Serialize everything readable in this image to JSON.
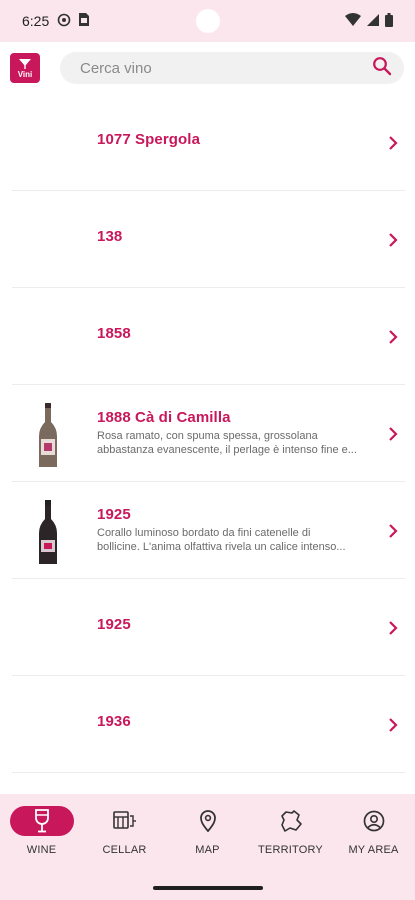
{
  "status_bar": {
    "time": "6:25"
  },
  "header": {
    "logo_text": "Vini",
    "search_placeholder": "Cerca vino"
  },
  "wines": [
    {
      "title": "1077 Spergola",
      "description": "",
      "has_image": false
    },
    {
      "title": "138",
      "description": "",
      "has_image": false
    },
    {
      "title": "1858",
      "description": "",
      "has_image": false
    },
    {
      "title": "1888 Cà di Camilla",
      "description_line1": "Rosa ramato, con spuma spessa, grossolana",
      "description_line2": "abbastanza evanescente, il perlage è intenso fine e...",
      "has_image": true,
      "bottle_color": "#6e5a4c"
    },
    {
      "title": "1925",
      "description_line1": "Corallo luminoso bordato da fini catenelle di",
      "description_line2": "bollicine. L'anima olfattiva rivela un calice intenso...",
      "has_image": true,
      "bottle_color": "#2a2326"
    },
    {
      "title": "1925",
      "description": "",
      "has_image": false
    },
    {
      "title": "1936",
      "description": "",
      "has_image": false
    }
  ],
  "nav": {
    "wine": "WINE",
    "cellar": "CELLAR",
    "map": "MAP",
    "territory": "TERRITORY",
    "my_area": "MY AREA"
  },
  "colors": {
    "accent": "#c8185b",
    "nav_bg": "#fbe6ee"
  },
  "icons": {
    "status": [
      "settings-icon",
      "sim-icon",
      "wifi-icon",
      "signal-icon",
      "battery-icon"
    ],
    "search": "search-icon",
    "nav": [
      "wine-glass-icon",
      "cellar-icon",
      "map-pin-icon",
      "territory-icon",
      "user-circle-icon"
    ]
  }
}
